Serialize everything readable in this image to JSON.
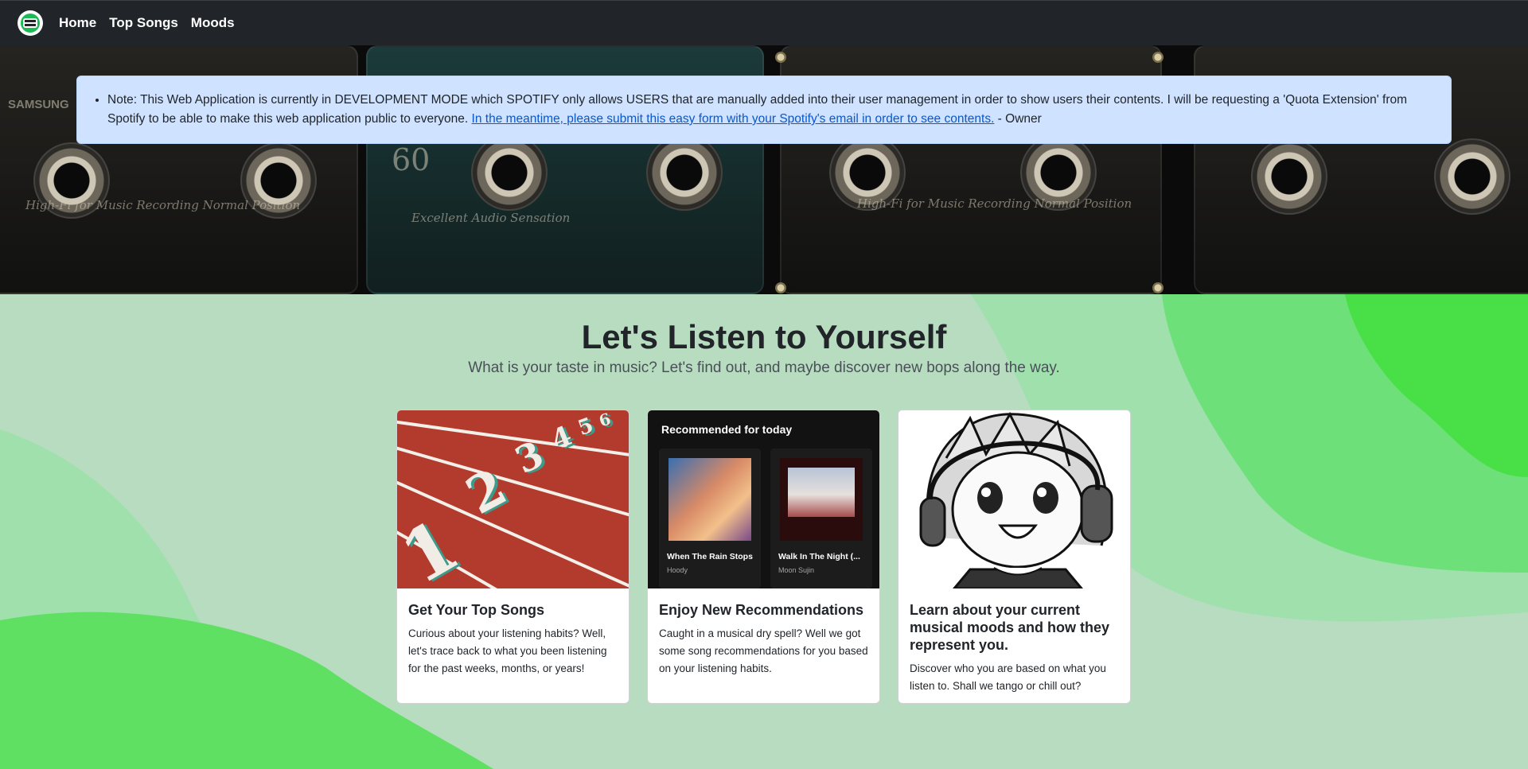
{
  "navbar": {
    "logo_icon": "app-logo-icon",
    "links": [
      "Home",
      "Top Songs",
      "Moods"
    ]
  },
  "hero": {
    "cassette_texts": {
      "brand": "SAMSUNG",
      "label_left": "High-Fi for Music Recording Normal Position",
      "number": "60",
      "label_mid": "Excellent Audio Sensation",
      "label_right": "High-Fi for Music Recording Normal Position"
    },
    "alert": {
      "prefix": "Note: This Web Application is currently in DEVELOPMENT MODE which SPOTIFY only allows USERS that are manually added into their user management in order to show users their contents. I will be requesting a 'Quota Extension' from Spotify to be able to make this web application public to everyone. ",
      "link_text": "In the meantime, please submit this easy form with your Spotify's email in order to see contents.",
      "suffix": " - Owner"
    }
  },
  "main": {
    "title": "Let's Listen to Yourself",
    "subtitle": "What is your taste in music? Let's find out, and maybe discover new bops along the way."
  },
  "cards": [
    {
      "title": "Get Your Top Songs",
      "text": "Curious about your listening habits? Well, let's trace back to what you been listening for the past weeks, months, or years!"
    },
    {
      "title": "Enjoy New Recommendations",
      "text": "Caught in a musical dry spell? Well we got some song recommendations for you based on your listening habits.",
      "image": {
        "heading": "Recommended for today",
        "tiles": [
          {
            "name": "When The Rain Stops",
            "artist": "Hoody"
          },
          {
            "name": "Walk In The Night (...",
            "artist": "Moon Sujin"
          }
        ]
      }
    },
    {
      "title": "Learn about your current musical moods and how they represent you.",
      "text": "Discover who you are based on what you listen to. Shall we tango or chill out?"
    }
  ],
  "colors": {
    "navbar": "#212529",
    "alert_bg": "#cfe2ff",
    "bg_light": "#b8dcc0",
    "bg_mid": "#9fe0ad",
    "bg_bright": "#6ee07a",
    "bg_vivid": "#49e047"
  }
}
